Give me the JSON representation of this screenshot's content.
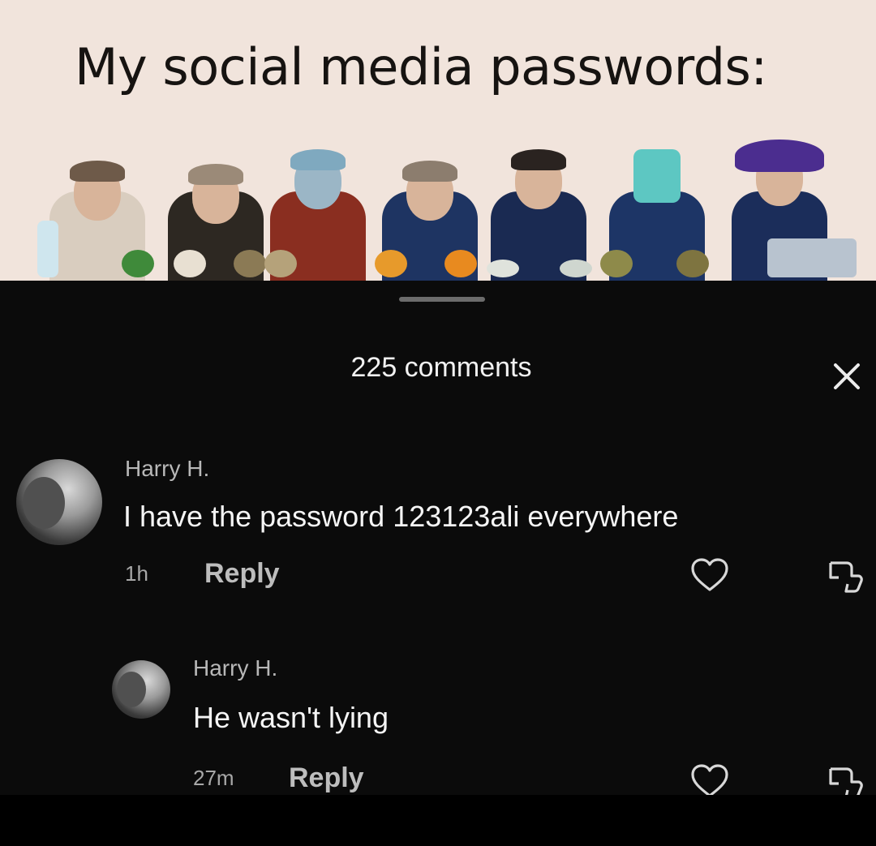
{
  "meme": {
    "title": "My social media passwords:"
  },
  "comments_sheet": {
    "count_label": "225 comments",
    "comments": [
      {
        "author": "Harry H.",
        "text": "I have the password 123123ali everywhere",
        "time": "1h",
        "reply_label": "Reply"
      },
      {
        "author": "Harry H.",
        "text": "He wasn't lying",
        "time": "27m",
        "reply_label": "Reply"
      }
    ]
  },
  "icons": {
    "close": "close-icon",
    "like": "heart-icon",
    "dislike": "thumbs-down-icon"
  },
  "colors": {
    "meme_background": "#f1e4dc",
    "sheet_background": "#0b0b0b",
    "primary_text": "#f5f5f5",
    "secondary_text": "#b8b8b8"
  }
}
